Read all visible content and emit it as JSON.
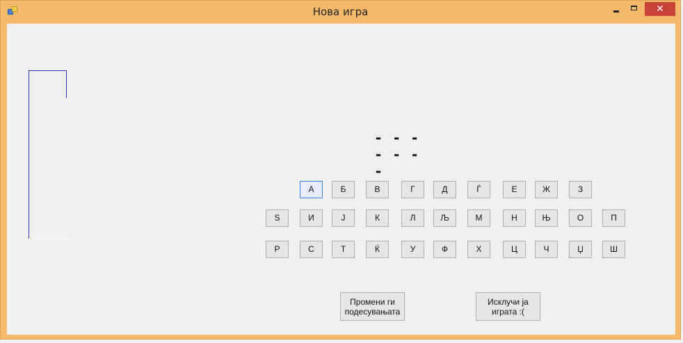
{
  "window": {
    "title": "Нова игра",
    "close_glyph": "✕"
  },
  "game": {
    "hidden_word": "- - - - - - -"
  },
  "letters": [
    [
      "А",
      "Б",
      "В",
      "Г",
      "Д",
      "Ѓ",
      "Е",
      "Ж",
      "З"
    ],
    [
      "Ѕ",
      "И",
      "Ј",
      "К",
      "Л",
      "Љ",
      "М",
      "Н",
      "Њ",
      "О",
      "П"
    ],
    [
      "Р",
      "С",
      "Т",
      "Ќ",
      "У",
      "Ф",
      "Х",
      "Ц",
      "Ч",
      "Џ",
      "Ш"
    ]
  ],
  "actions": {
    "settings_label": "Промени ги\nподесувањата",
    "quit_label": "Исклучи ја\nиграта :("
  },
  "colors": {
    "window_frame": "#f5b96b",
    "close_button": "#c7423b",
    "gallows_line": "#3030b0"
  },
  "icons": {
    "app": "app-icon",
    "minimize": "minimize-icon",
    "maximize": "maximize-icon",
    "close": "close-icon"
  }
}
